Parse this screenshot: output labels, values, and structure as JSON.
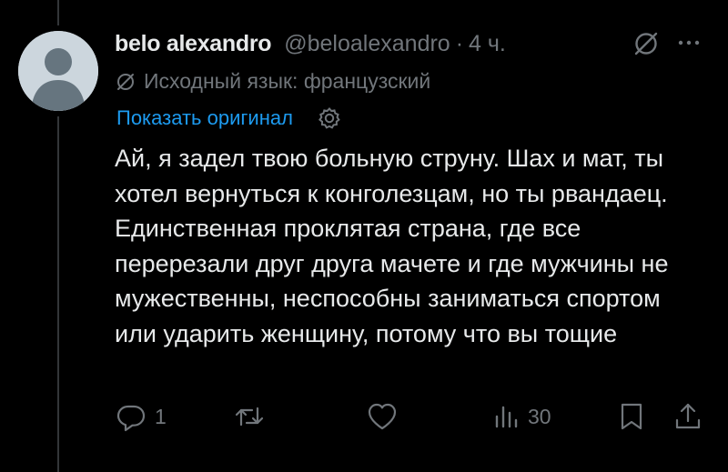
{
  "author": {
    "name": "belo alexandro",
    "handle": "@beloalexandro",
    "separator": "·",
    "time": "4 ч."
  },
  "translation": {
    "source_language": "Исходный язык: французский",
    "show_original": "Показать оригинал"
  },
  "tweet": {
    "text": "Ай, я задел твою больную струну. Шах и мат, ты хотел вернуться к конголезцам, но ты рвандаец. Единственная проклятая страна, где все перерезали друг друга мачете и где мужчины не мужественны, неспособны заниматься спортом или ударить женщину, потому что вы тощие"
  },
  "actions": {
    "reply_count": "1",
    "retweet_count": "",
    "like_count": "",
    "views_count": "30"
  },
  "icons": {
    "grok": "grok-icon",
    "more": "more-icon",
    "translate": "translate-icon",
    "settings": "gear-icon",
    "reply": "reply-icon",
    "retweet": "retweet-icon",
    "like": "heart-icon",
    "views": "views-icon",
    "bookmark": "bookmark-icon",
    "share": "share-icon"
  },
  "colors": {
    "background": "#000000",
    "text": "#e7e9ea",
    "muted": "#71767b",
    "link": "#1d9bf0",
    "thread_line": "#333639"
  }
}
